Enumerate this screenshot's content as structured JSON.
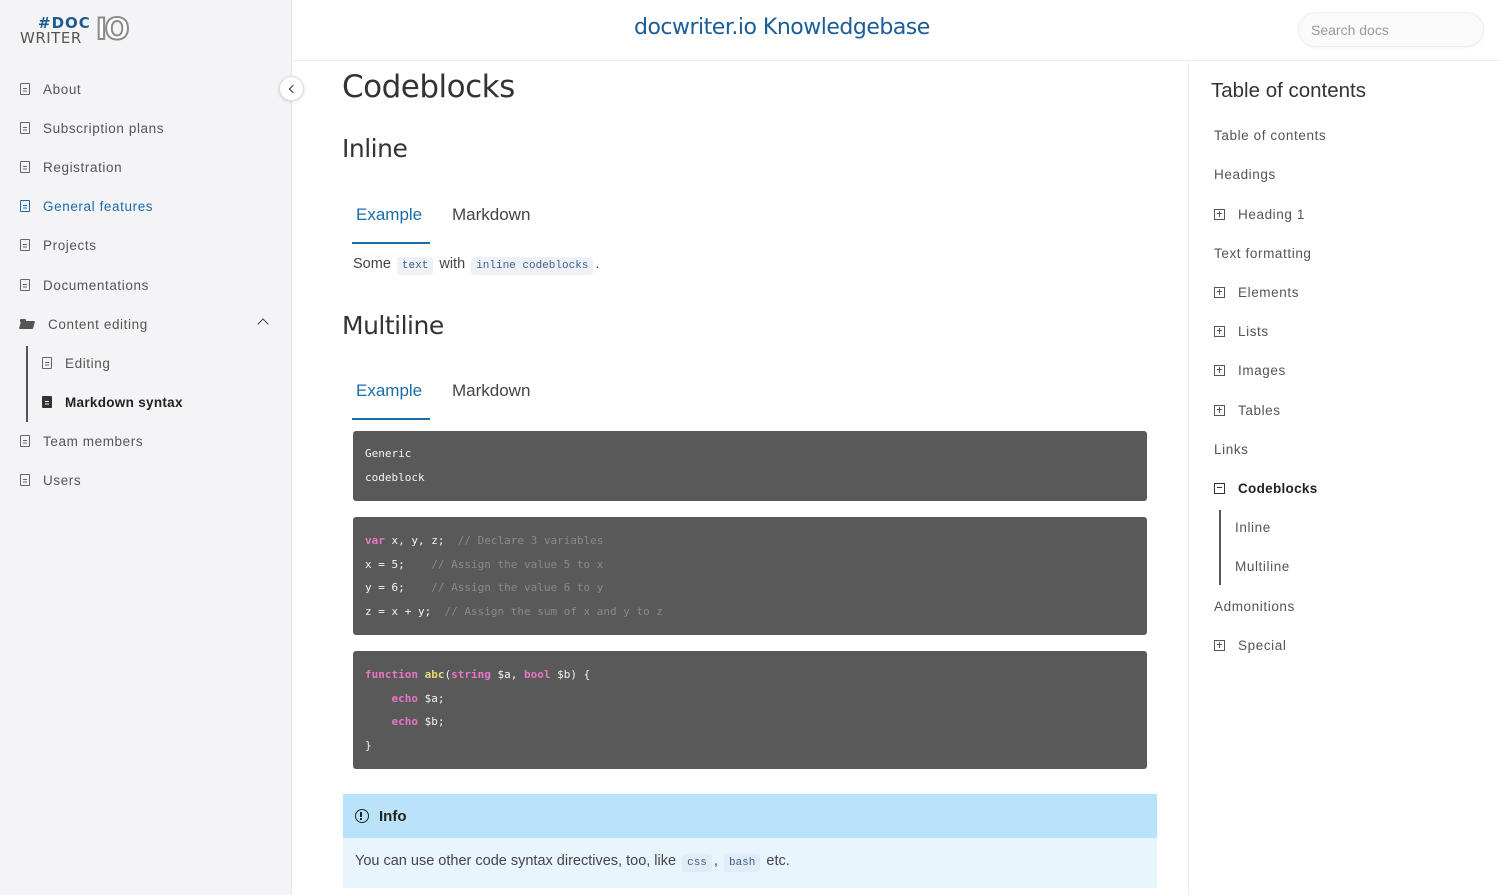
{
  "logo": {
    "hash": "#DOC",
    "writer": "WRITER",
    "io": "IO"
  },
  "header": {
    "title": "docwriter.io Knowledgebase",
    "search_placeholder": "Search docs"
  },
  "sidebar": {
    "items": [
      {
        "label": "About"
      },
      {
        "label": "Subscription plans"
      },
      {
        "label": "Registration"
      },
      {
        "label": "General features"
      },
      {
        "label": "Projects"
      },
      {
        "label": "Documentations"
      },
      {
        "label": "Content editing"
      },
      {
        "label": "Editing"
      },
      {
        "label": "Markdown syntax"
      },
      {
        "label": "Team members"
      },
      {
        "label": "Users"
      }
    ]
  },
  "main": {
    "title": "Codeblocks",
    "inline": {
      "heading": "Inline",
      "tabs": [
        "Example",
        "Markdown"
      ],
      "text_before": "Some",
      "code1": "text",
      "text_mid": "with",
      "code2": "inline codeblocks",
      "text_after": "."
    },
    "multiline": {
      "heading": "Multiline",
      "tabs": [
        "Example",
        "Markdown"
      ],
      "block1": [
        "Generic",
        "codeblock"
      ],
      "block2": [
        {
          "kw": "var",
          "code": " x, y, z;  ",
          "comment": "// Declare 3 variables"
        },
        {
          "kw": "",
          "code": "x = 5;    ",
          "comment": "// Assign the value 5 to x"
        },
        {
          "kw": "",
          "code": "y = 6;    ",
          "comment": "// Assign the value 6 to y"
        },
        {
          "kw": "",
          "code": "z = x + y;  ",
          "comment": "// Assign the sum of x and y to z"
        }
      ],
      "block3": {
        "l1_kw": "function",
        "l1_fn": "abc",
        "l1_a": "(",
        "l1_t1": "string",
        "l1_b": " $a, ",
        "l1_t2": "bool",
        "l1_c": " $b) {",
        "l2_kw": "echo",
        "l2": " $a;",
        "l3_kw": "echo",
        "l3": " $b;",
        "l4": "}"
      }
    },
    "admonition": {
      "title": "Info",
      "text_before": "You can use other code syntax directives, too, like",
      "code1": "css",
      "sep": ",",
      "code2": "bash",
      "text_after": "etc."
    }
  },
  "toc": {
    "title": "Table of contents",
    "items": [
      {
        "label": "Table of contents"
      },
      {
        "label": "Headings"
      },
      {
        "label": "Heading 1"
      },
      {
        "label": "Text formatting"
      },
      {
        "label": "Elements"
      },
      {
        "label": "Lists"
      },
      {
        "label": "Images"
      },
      {
        "label": "Tables"
      },
      {
        "label": "Links"
      },
      {
        "label": "Codeblocks"
      },
      {
        "label": "Inline"
      },
      {
        "label": "Multiline"
      },
      {
        "label": "Admonitions"
      },
      {
        "label": "Special"
      }
    ]
  }
}
